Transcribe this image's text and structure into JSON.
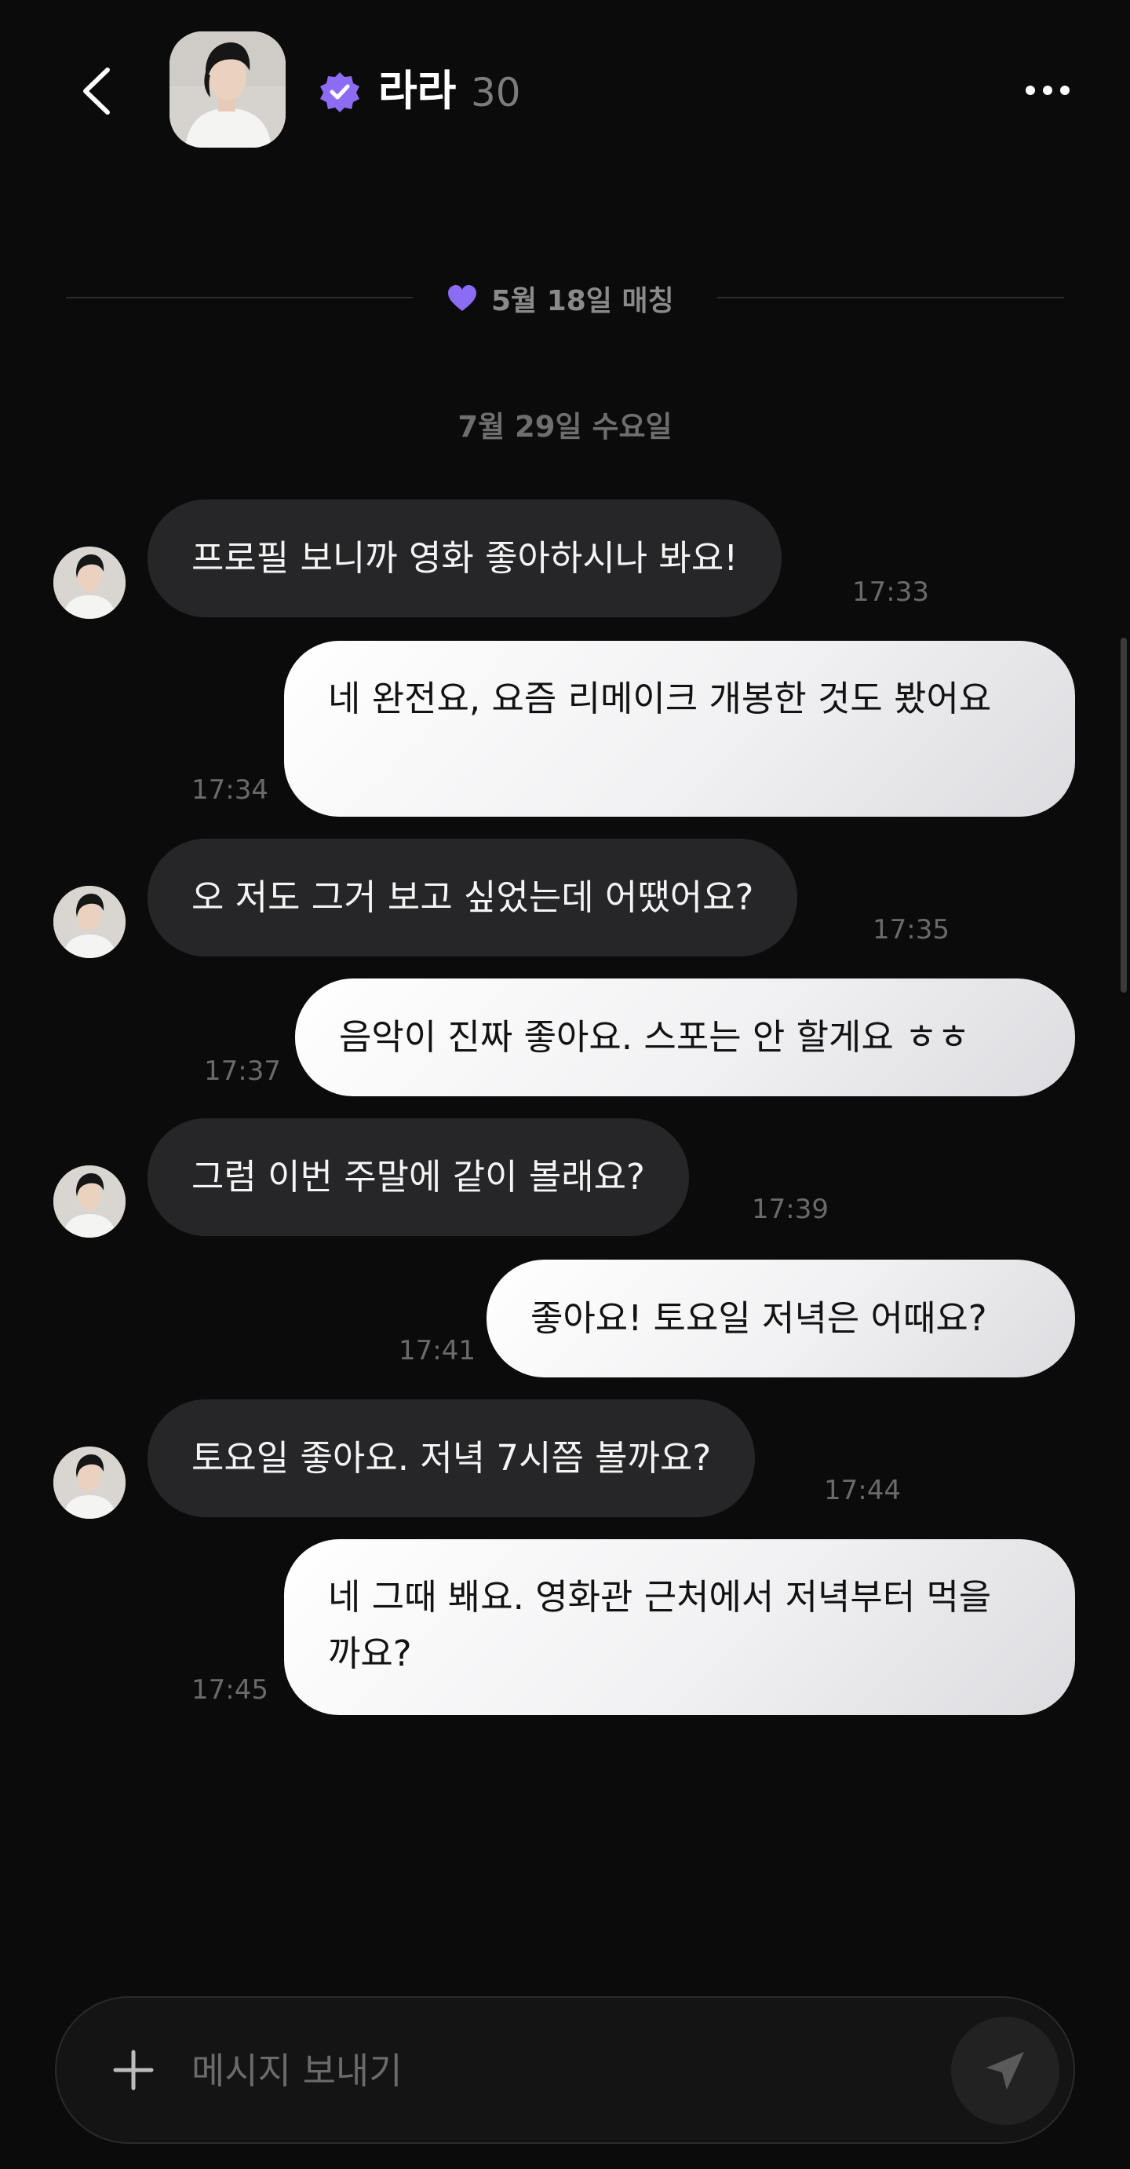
{
  "header": {
    "name": "라라",
    "age": "30",
    "back_icon": "chevron-left-icon",
    "verified_icon": "verified-badge-icon",
    "more_icon": "more-horizontal-icon"
  },
  "match": {
    "label": "5월 18일 매칭",
    "icon": "heart-icon",
    "heart_color": "#8b6cf2"
  },
  "date_separator": "7월 29일 수요일",
  "messages": [
    {
      "from": "them",
      "text": "프로필 보니까 영화 좋아하시나 봐요!",
      "time": "17:33"
    },
    {
      "from": "me",
      "text": "네 완전요, 요즘 리메이크 개봉한 것도 봤어요",
      "time": "17:34"
    },
    {
      "from": "them",
      "text": "오 저도 그거 보고 싶었는데 어땠어요?",
      "time": "17:35"
    },
    {
      "from": "me",
      "text": "음악이 진짜 좋아요. 스포는 안 할게요 ㅎㅎ",
      "time": "17:37"
    },
    {
      "from": "them",
      "text": "그럼 이번 주말에 같이 볼래요?",
      "time": "17:39"
    },
    {
      "from": "me",
      "text": "좋아요! 토요일 저녁은 어때요?",
      "time": "17:41"
    },
    {
      "from": "them",
      "text": "토요일 좋아요. 저녁 7시쯤 볼까요?",
      "time": "17:44"
    },
    {
      "from": "me",
      "text": "네 그때 봬요. 영화관 근처에서 저녁부터 먹을까요?",
      "time": "17:45"
    }
  ],
  "composer": {
    "placeholder": "메시지 보내기",
    "value": "",
    "plus_icon": "plus-icon",
    "send_icon": "send-icon"
  },
  "colors": {
    "background": "#0b0b0b",
    "incoming_bubble": "#262629",
    "outgoing_bubble": "#f1f1f3",
    "accent": "#8b6cf2"
  }
}
